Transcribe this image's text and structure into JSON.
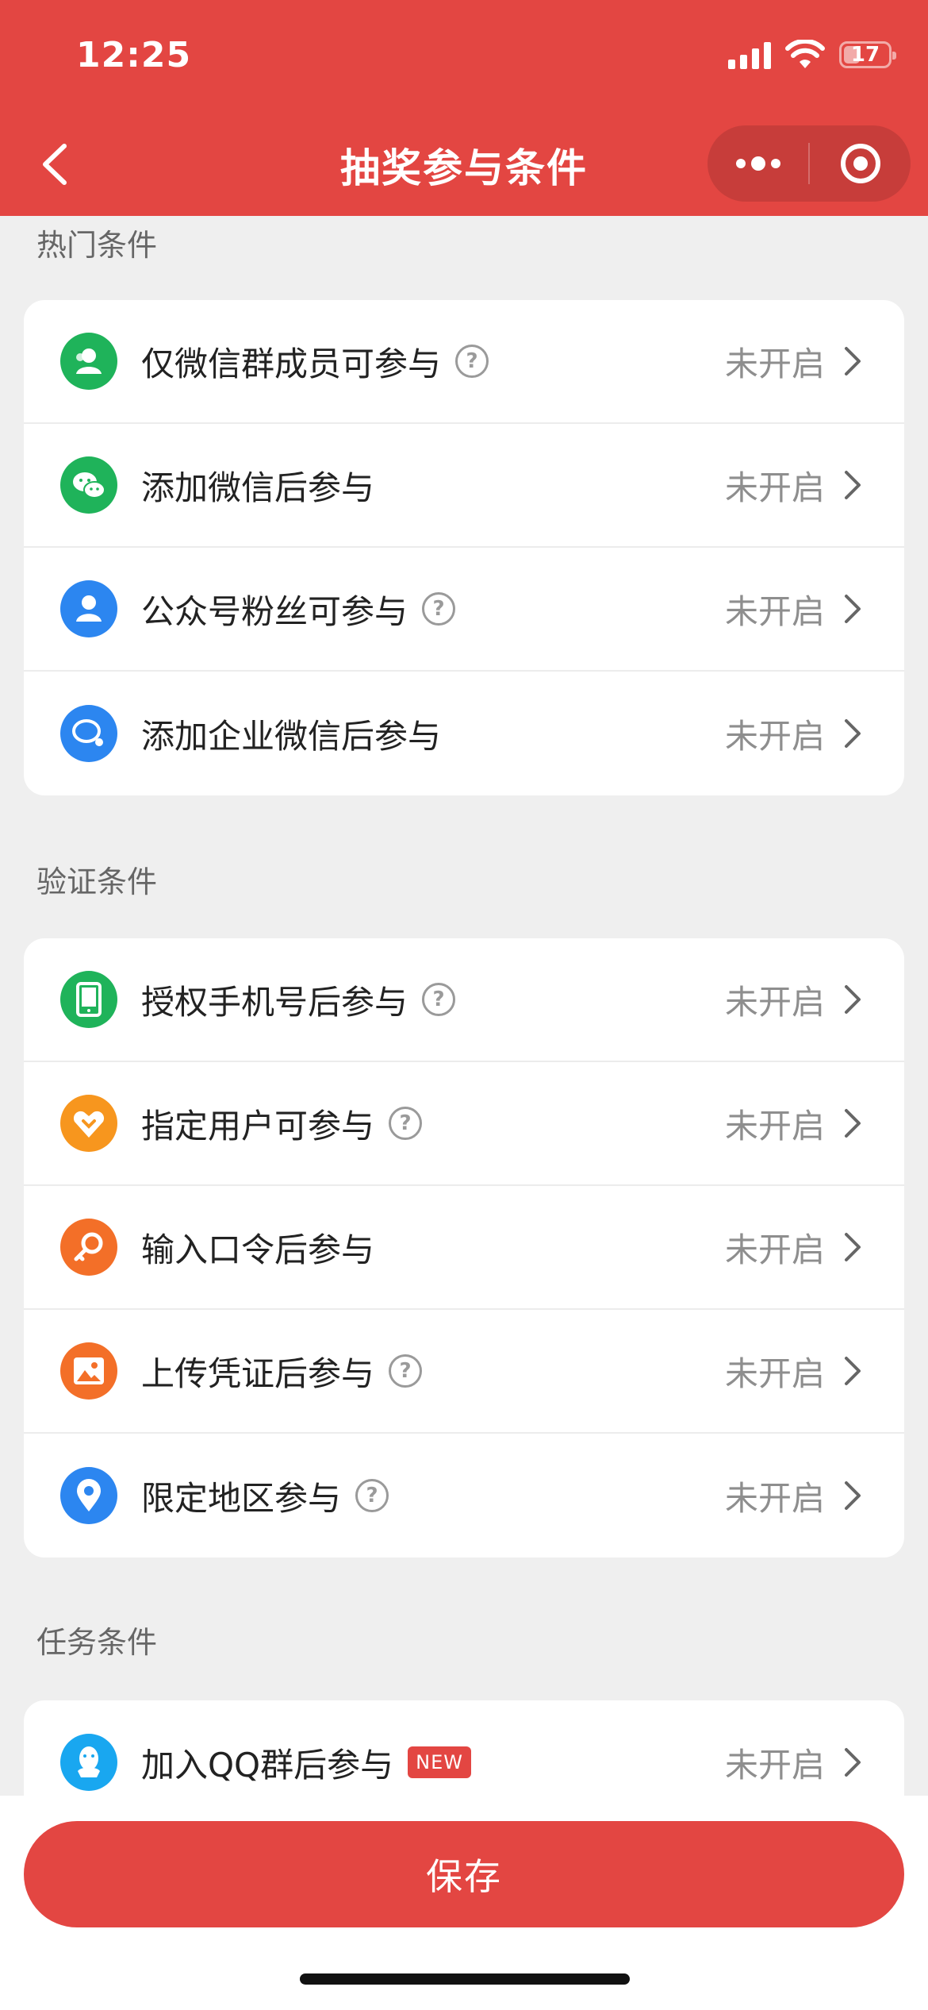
{
  "status_bar": {
    "time": "12:25",
    "battery": "17"
  },
  "nav": {
    "title": "抽奖参与条件"
  },
  "sections": {
    "hot": {
      "title": "热门条件",
      "items": [
        {
          "label": "仅微信群成员可参与",
          "state": "未开启",
          "icon": "group-user-icon",
          "color": "#1fb35a",
          "help": true
        },
        {
          "label": "添加微信后参与",
          "state": "未开启",
          "icon": "wechat-icon",
          "color": "#1fb35a",
          "help": false
        },
        {
          "label": "公众号粉丝可参与",
          "state": "未开启",
          "icon": "user-icon",
          "color": "#2c86f0",
          "help": true
        },
        {
          "label": "添加企业微信后参与",
          "state": "未开启",
          "icon": "wecom-icon",
          "color": "#2c86f0",
          "help": false
        }
      ]
    },
    "verify": {
      "title": "验证条件",
      "items": [
        {
          "label": "授权手机号后参与",
          "state": "未开启",
          "icon": "phone-icon",
          "color": "#1fb35a",
          "help": true
        },
        {
          "label": "指定用户可参与",
          "state": "未开启",
          "icon": "heart-icon",
          "color": "#f7961e",
          "help": true
        },
        {
          "label": "输入口令后参与",
          "state": "未开启",
          "icon": "key-icon",
          "color": "#f36f28",
          "help": false
        },
        {
          "label": "上传凭证后参与",
          "state": "未开启",
          "icon": "image-icon",
          "color": "#f36f28",
          "help": true
        },
        {
          "label": "限定地区参与",
          "state": "未开启",
          "icon": "location-pin-icon",
          "color": "#2c86f0",
          "help": true
        }
      ]
    },
    "task": {
      "title": "任务条件",
      "items": [
        {
          "label": "加入QQ群后参与",
          "state": "未开启",
          "icon": "qq-icon",
          "color": "#19a7f0",
          "badge": "NEW"
        }
      ]
    }
  },
  "help_glyph": "?",
  "save_label": "保存"
}
